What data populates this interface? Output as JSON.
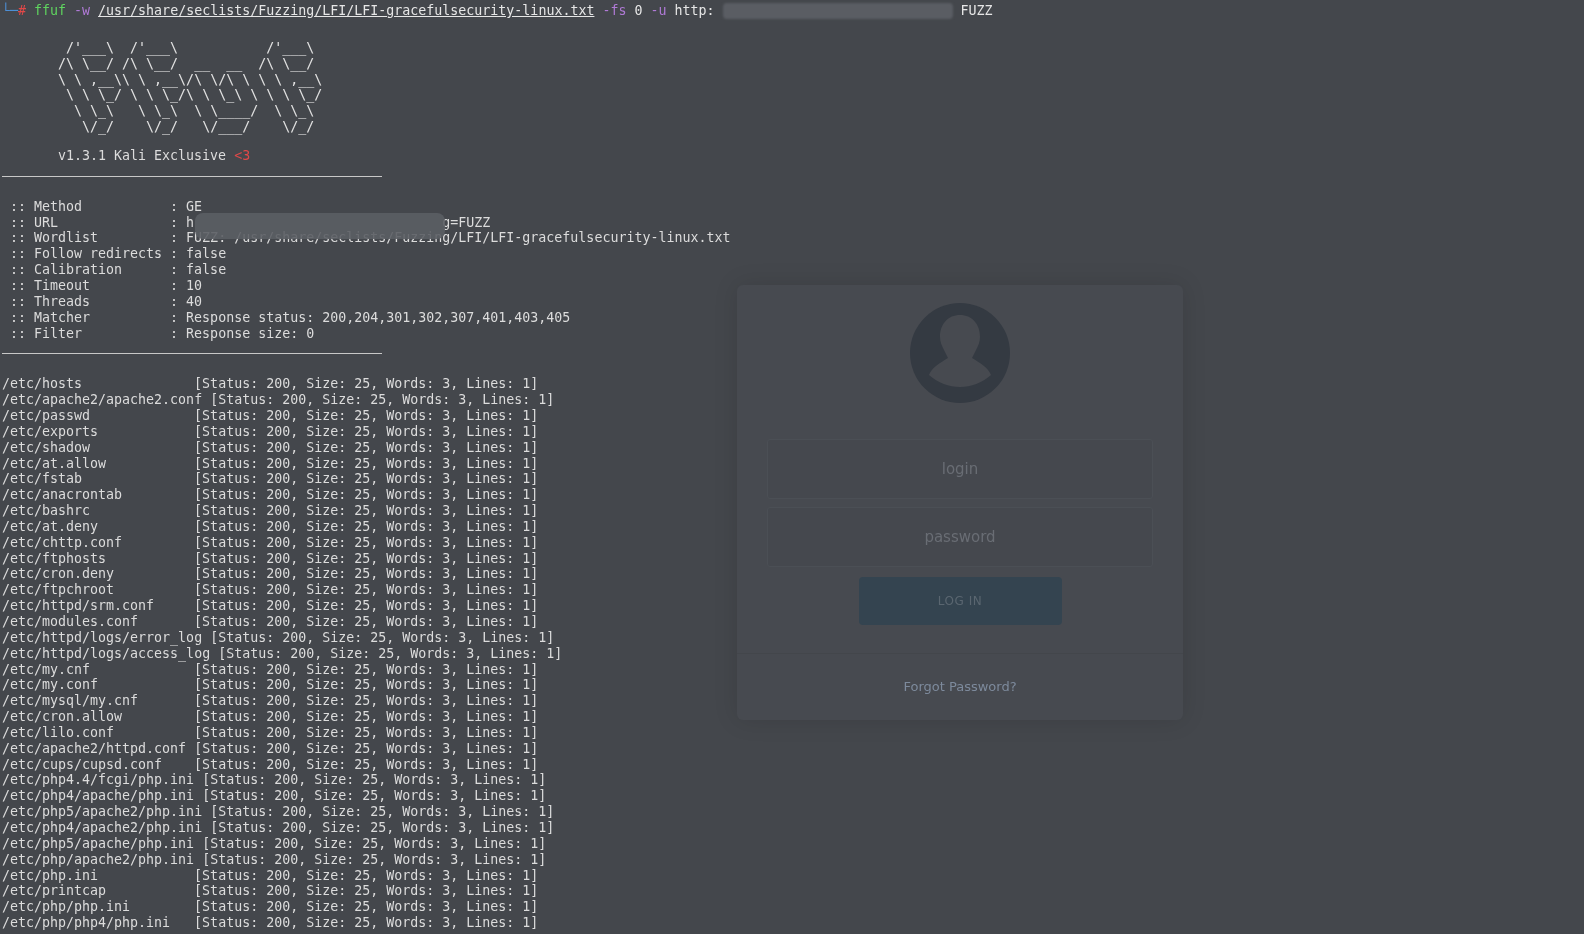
{
  "command": {
    "prompt": "└─",
    "symbol": "#",
    "tokens": [
      {
        "kind": "command",
        "text": "ffuf"
      },
      {
        "kind": "flag",
        "text": "-w"
      },
      {
        "kind": "path",
        "text": "/usr/share/seclists/Fuzzing/LFI/LFI-gracefulsecurity-linux.txt"
      },
      {
        "kind": "flag",
        "text": "-fs"
      },
      {
        "kind": "arg",
        "text": "0"
      },
      {
        "kind": "flag",
        "text": "-u"
      },
      {
        "kind": "arg",
        "text": "http:"
      },
      {
        "kind": "redacted"
      },
      {
        "kind": "arg",
        "text": "FUZZ"
      }
    ]
  },
  "banner": {
    "art": [
      "        /'___\\  /'___\\           /'___\\",
      "       /\\ \\__/ /\\ \\__/  __  __  /\\ \\__/",
      "       \\ \\ ,__\\\\ \\ ,__\\/\\ \\/\\ \\ \\ \\ ,__\\",
      "        \\ \\ \\_/ \\ \\ \\_/\\ \\ \\_\\ \\ \\ \\ \\_/",
      "         \\ \\_\\   \\ \\_\\  \\ \\____/  \\ \\_\\",
      "          \\/_/    \\/_/   \\/___/    \\/_/"
    ],
    "version": "v1.3.1 Kali Exclusive",
    "heart": "<3"
  },
  "config": [
    {
      "label": ":: Method",
      "value": ": GE"
    },
    {
      "label": ":: URL",
      "value": ": h",
      "value_end": "g=FUZZ"
    },
    {
      "label": ":: Wordlist",
      "value": ": FUZZ: /usr/share/seclists/Fuzzing/LFI/LFI-gracefulsecurity-linux.txt"
    },
    {
      "label": ":: Follow redirects",
      "value": ": false"
    },
    {
      "label": ":: Calibration",
      "value": ": false"
    },
    {
      "label": ":: Timeout",
      "value": ": 10"
    },
    {
      "label": ":: Threads",
      "value": ": 40"
    },
    {
      "label": ":: Matcher",
      "value": ": Response status: 200,204,301,302,307,401,403,405"
    },
    {
      "label": ":: Filter",
      "value": ": Response size: 0"
    }
  ],
  "results": [
    {
      "path": "/etc/hosts",
      "info": "[Status: 200, Size: 25, Words: 3, Lines: 1]"
    },
    {
      "path": "/etc/apache2/apache2.conf",
      "info": "[Status: 200, Size: 25, Words: 3, Lines: 1]"
    },
    {
      "path": "/etc/passwd",
      "info": "[Status: 200, Size: 25, Words: 3, Lines: 1]"
    },
    {
      "path": "/etc/exports",
      "info": "[Status: 200, Size: 25, Words: 3, Lines: 1]"
    },
    {
      "path": "/etc/shadow",
      "info": "[Status: 200, Size: 25, Words: 3, Lines: 1]"
    },
    {
      "path": "/etc/at.allow",
      "info": "[Status: 200, Size: 25, Words: 3, Lines: 1]"
    },
    {
      "path": "/etc/fstab",
      "info": "[Status: 200, Size: 25, Words: 3, Lines: 1]"
    },
    {
      "path": "/etc/anacrontab",
      "info": "[Status: 200, Size: 25, Words: 3, Lines: 1]"
    },
    {
      "path": "/etc/bashrc",
      "info": "[Status: 200, Size: 25, Words: 3, Lines: 1]"
    },
    {
      "path": "/etc/at.deny",
      "info": "[Status: 200, Size: 25, Words: 3, Lines: 1]"
    },
    {
      "path": "/etc/chttp.conf",
      "info": "[Status: 200, Size: 25, Words: 3, Lines: 1]"
    },
    {
      "path": "/etc/ftphosts",
      "info": "[Status: 200, Size: 25, Words: 3, Lines: 1]"
    },
    {
      "path": "/etc/cron.deny",
      "info": "[Status: 200, Size: 25, Words: 3, Lines: 1]"
    },
    {
      "path": "/etc/ftpchroot",
      "info": "[Status: 200, Size: 25, Words: 3, Lines: 1]"
    },
    {
      "path": "/etc/httpd/srm.conf",
      "info": "[Status: 200, Size: 25, Words: 3, Lines: 1]"
    },
    {
      "path": "/etc/modules.conf",
      "info": "[Status: 200, Size: 25, Words: 3, Lines: 1]"
    },
    {
      "path": "/etc/httpd/logs/error_log",
      "info": "[Status: 200, Size: 25, Words: 3, Lines: 1]"
    },
    {
      "path": "/etc/httpd/logs/access_log",
      "info": "[Status: 200, Size: 25, Words: 3, Lines: 1]"
    },
    {
      "path": "/etc/my.cnf",
      "info": "[Status: 200, Size: 25, Words: 3, Lines: 1]"
    },
    {
      "path": "/etc/my.conf",
      "info": "[Status: 200, Size: 25, Words: 3, Lines: 1]"
    },
    {
      "path": "/etc/mysql/my.cnf",
      "info": "[Status: 200, Size: 25, Words: 3, Lines: 1]"
    },
    {
      "path": "/etc/cron.allow",
      "info": "[Status: 200, Size: 25, Words: 3, Lines: 1]"
    },
    {
      "path": "/etc/lilo.conf",
      "info": "[Status: 200, Size: 25, Words: 3, Lines: 1]"
    },
    {
      "path": "/etc/apache2/httpd.conf",
      "info": "[Status: 200, Size: 25, Words: 3, Lines: 1]"
    },
    {
      "path": "/etc/cups/cupsd.conf",
      "info": "[Status: 200, Size: 25, Words: 3, Lines: 1]"
    },
    {
      "path": "/etc/php4.4/fcgi/php.ini",
      "info": "[Status: 200, Size: 25, Words: 3, Lines: 1]"
    },
    {
      "path": "/etc/php4/apache/php.ini",
      "info": "[Status: 200, Size: 25, Words: 3, Lines: 1]"
    },
    {
      "path": "/etc/php5/apache2/php.ini",
      "info": "[Status: 200, Size: 25, Words: 3, Lines: 1]"
    },
    {
      "path": "/etc/php4/apache2/php.ini",
      "info": "[Status: 200, Size: 25, Words: 3, Lines: 1]"
    },
    {
      "path": "/etc/php5/apache/php.ini",
      "info": "[Status: 200, Size: 25, Words: 3, Lines: 1]"
    },
    {
      "path": "/etc/php/apache2/php.ini",
      "info": "[Status: 200, Size: 25, Words: 3, Lines: 1]"
    },
    {
      "path": "/etc/php.ini",
      "info": "[Status: 200, Size: 25, Words: 3, Lines: 1]"
    },
    {
      "path": "/etc/printcap",
      "info": "[Status: 200, Size: 25, Words: 3, Lines: 1]"
    },
    {
      "path": "/etc/php/php.ini",
      "info": "[Status: 200, Size: 25, Words: 3, Lines: 1]"
    },
    {
      "path": "/etc/php/php4/php.ini",
      "info": "[Status: 200, Size: 25, Words: 3, Lines: 1]"
    }
  ],
  "login": {
    "login_placeholder": "login",
    "password_placeholder": "password",
    "button": "LOG IN",
    "forgot_link": "Forgot Password?"
  }
}
